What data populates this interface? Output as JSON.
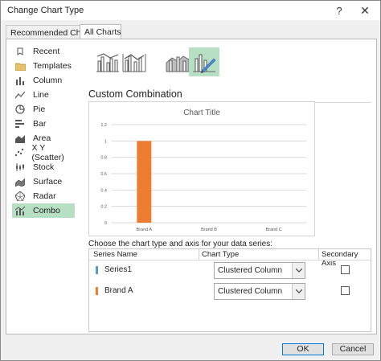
{
  "window": {
    "title": "Change Chart Type",
    "help_glyph": "?",
    "close_glyph": "✕"
  },
  "tabs": [
    {
      "label": "Recommended Charts"
    },
    {
      "label": "All Charts"
    }
  ],
  "sidebar": {
    "items": [
      {
        "label": "Recent",
        "icon": "recent-icon"
      },
      {
        "label": "Templates",
        "icon": "templates-folder-icon"
      },
      {
        "label": "Column",
        "icon": "column-chart-icon"
      },
      {
        "label": "Line",
        "icon": "line-chart-icon"
      },
      {
        "label": "Pie",
        "icon": "pie-chart-icon"
      },
      {
        "label": "Bar",
        "icon": "bar-chart-icon"
      },
      {
        "label": "Area",
        "icon": "area-chart-icon"
      },
      {
        "label": "X Y (Scatter)",
        "icon": "scatter-chart-icon"
      },
      {
        "label": "Stock",
        "icon": "stock-chart-icon"
      },
      {
        "label": "Surface",
        "icon": "surface-chart-icon"
      },
      {
        "label": "Radar",
        "icon": "radar-chart-icon"
      },
      {
        "label": "Combo",
        "icon": "combo-chart-icon",
        "selected": true
      }
    ]
  },
  "subtypes": [
    {
      "icon": "clustered-column-line-icon"
    },
    {
      "icon": "clustered-column-line-secondary-icon"
    },
    {
      "icon": "stacked-area-clustered-column-icon"
    },
    {
      "icon": "custom-combination-icon",
      "selected": true
    }
  ],
  "section_title": "Custom Combination",
  "chart_data": {
    "type": "bar",
    "title": "Chart Title",
    "categories": [
      "Brand A",
      "Brand B",
      "Brand C"
    ],
    "series": [
      {
        "name": "Brand A",
        "values": [
          1,
          0,
          0
        ],
        "color": "#ed7d31"
      }
    ],
    "yticks": [
      "0",
      "0.2",
      "0.4",
      "0.6",
      "0.8",
      "1",
      "1.2"
    ],
    "ylim": [
      0,
      1.2
    ],
    "grid": true
  },
  "series_config": {
    "prompt": "Choose the chart type and axis for your data series:",
    "headers": {
      "series_name": "Series Name",
      "chart_type": "Chart Type",
      "secondary_axis": "Secondary Axis"
    },
    "rows": [
      {
        "name": "Series1",
        "color": "#5b9bd5",
        "chart_type": "Clustered Column",
        "secondary": false
      },
      {
        "name": "Brand A",
        "color": "#ed7d31",
        "chart_type": "Clustered Column",
        "secondary": false
      }
    ]
  },
  "buttons": {
    "ok": "OK",
    "cancel": "Cancel"
  },
  "colors": {
    "selection": "#b6dfc4",
    "accent_orange": "#ed7d31",
    "accent_blue": "#5b9bd5"
  }
}
